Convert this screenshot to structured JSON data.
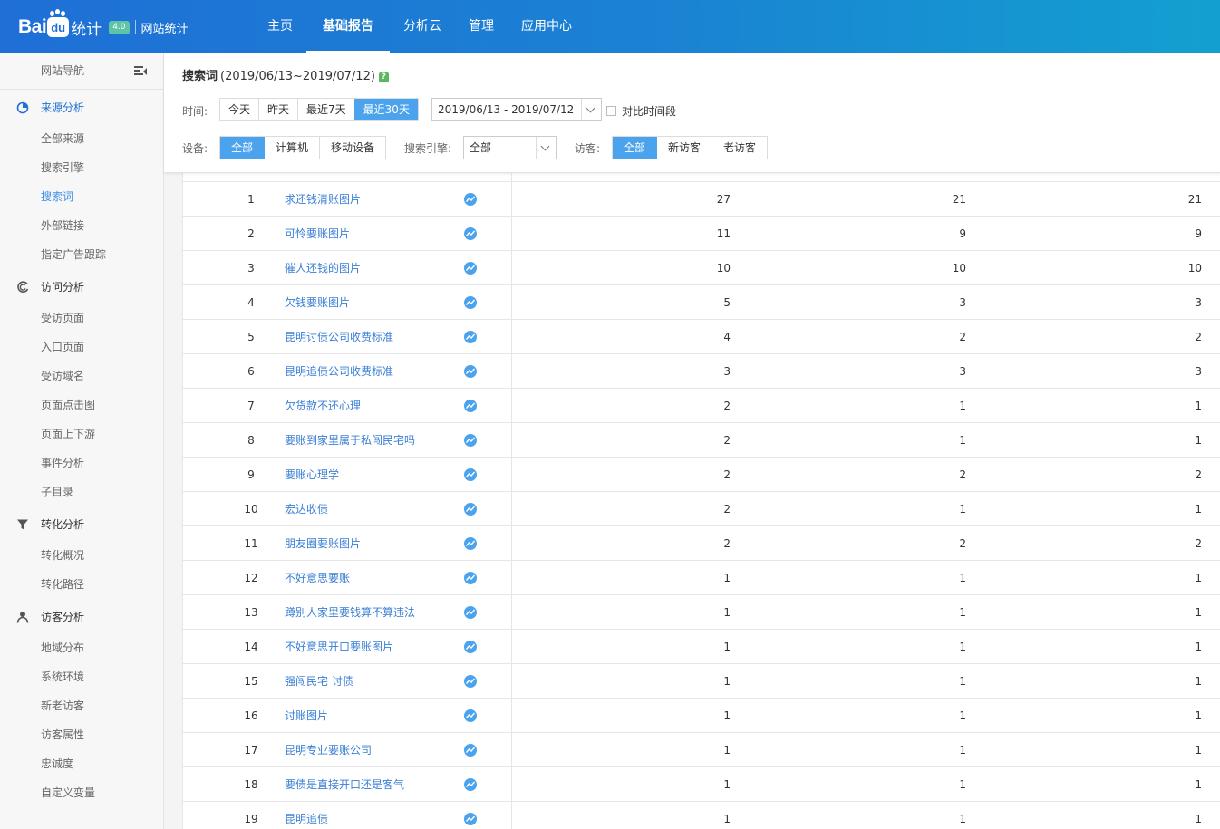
{
  "app": {
    "logo_text": "Bai",
    "logo_paw": "du",
    "logo_tongji": "统计",
    "version": "4.0",
    "subtitle": "网站统计"
  },
  "nav": [
    "主页",
    "基础报告",
    "分析云",
    "管理",
    "应用中心"
  ],
  "nav_active_index": 1,
  "sidebar": {
    "header": "网站导航",
    "groups": [
      {
        "title": "来源分析",
        "icon": "pie-chart-icon",
        "active": true,
        "items": [
          "全部来源",
          "搜索引擎",
          "搜索词",
          "外部链接",
          "指定广告跟踪"
        ],
        "active_item": "搜索词"
      },
      {
        "title": "访问分析",
        "icon": "spiral-icon",
        "items": [
          "受访页面",
          "入口页面",
          "受访域名",
          "页面点击图",
          "页面上下游",
          "事件分析",
          "子目录"
        ]
      },
      {
        "title": "转化分析",
        "icon": "funnel-icon",
        "items": [
          "转化概况",
          "转化路径"
        ]
      },
      {
        "title": "访客分析",
        "icon": "user-icon",
        "items": [
          "地域分布",
          "系统环境",
          "新老访客",
          "访客属性",
          "忠诚度",
          "自定义变量"
        ]
      }
    ]
  },
  "page": {
    "title": "搜索词",
    "range": "(2019/06/13~2019/07/12)",
    "help": "?"
  },
  "filters": {
    "time_label": "时间:",
    "time_options": [
      "今天",
      "昨天",
      "最近7天",
      "最近30天"
    ],
    "time_selected": 3,
    "date_range": "2019/06/13 - 2019/07/12",
    "compare_label": "对比时间段",
    "device_label": "设备:",
    "device_options": [
      "全部",
      "计算机",
      "移动设备"
    ],
    "device_selected": 0,
    "engine_label": "搜索引擎:",
    "engine_value": "全部",
    "visitor_label": "访客:",
    "visitor_options": [
      "全部",
      "新访客",
      "老访客"
    ],
    "visitor_selected": 0
  },
  "table": {
    "rows": [
      {
        "idx": "1",
        "keyword": "求还钱清账图片",
        "v1": "27",
        "v2": "21",
        "v3": "21"
      },
      {
        "idx": "2",
        "keyword": "可怜要账图片",
        "v1": "11",
        "v2": "9",
        "v3": "9"
      },
      {
        "idx": "3",
        "keyword": "催人还钱的图片",
        "v1": "10",
        "v2": "10",
        "v3": "10"
      },
      {
        "idx": "4",
        "keyword": "欠钱要账图片",
        "v1": "5",
        "v2": "3",
        "v3": "3"
      },
      {
        "idx": "5",
        "keyword": "昆明讨债公司收费标准",
        "v1": "4",
        "v2": "2",
        "v3": "2"
      },
      {
        "idx": "6",
        "keyword": "昆明追债公司收费标准",
        "v1": "3",
        "v2": "3",
        "v3": "3"
      },
      {
        "idx": "7",
        "keyword": "欠货款不还心理",
        "v1": "2",
        "v2": "1",
        "v3": "1"
      },
      {
        "idx": "8",
        "keyword": "要账到家里属于私闯民宅吗",
        "v1": "2",
        "v2": "1",
        "v3": "1"
      },
      {
        "idx": "9",
        "keyword": "要账心理学",
        "v1": "2",
        "v2": "2",
        "v3": "2"
      },
      {
        "idx": "10",
        "keyword": "宏达收债",
        "v1": "2",
        "v2": "1",
        "v3": "1"
      },
      {
        "idx": "11",
        "keyword": "朋友圈要账图片",
        "v1": "2",
        "v2": "2",
        "v3": "2"
      },
      {
        "idx": "12",
        "keyword": "不好意思要账",
        "v1": "1",
        "v2": "1",
        "v3": "1"
      },
      {
        "idx": "13",
        "keyword": "蹲别人家里要钱算不算违法",
        "v1": "1",
        "v2": "1",
        "v3": "1"
      },
      {
        "idx": "14",
        "keyword": "不好意思开口要账图片",
        "v1": "1",
        "v2": "1",
        "v3": "1"
      },
      {
        "idx": "15",
        "keyword": "强闯民宅 讨债",
        "v1": "1",
        "v2": "1",
        "v3": "1"
      },
      {
        "idx": "16",
        "keyword": "讨账图片",
        "v1": "1",
        "v2": "1",
        "v3": "1"
      },
      {
        "idx": "17",
        "keyword": "昆明专业要账公司",
        "v1": "1",
        "v2": "1",
        "v3": "1"
      },
      {
        "idx": "18",
        "keyword": "要债是直接开口还是客气",
        "v1": "1",
        "v2": "1",
        "v3": "1"
      },
      {
        "idx": "19",
        "keyword": "昆明追债",
        "v1": "1",
        "v2": "1",
        "v3": "1"
      }
    ],
    "trend_icon": "trend-chart-icon"
  },
  "colors": {
    "header_start": "#1f6fd6",
    "header_end": "#13a0d0",
    "accent": "#4aa3ec",
    "link": "#3a7fd5"
  }
}
